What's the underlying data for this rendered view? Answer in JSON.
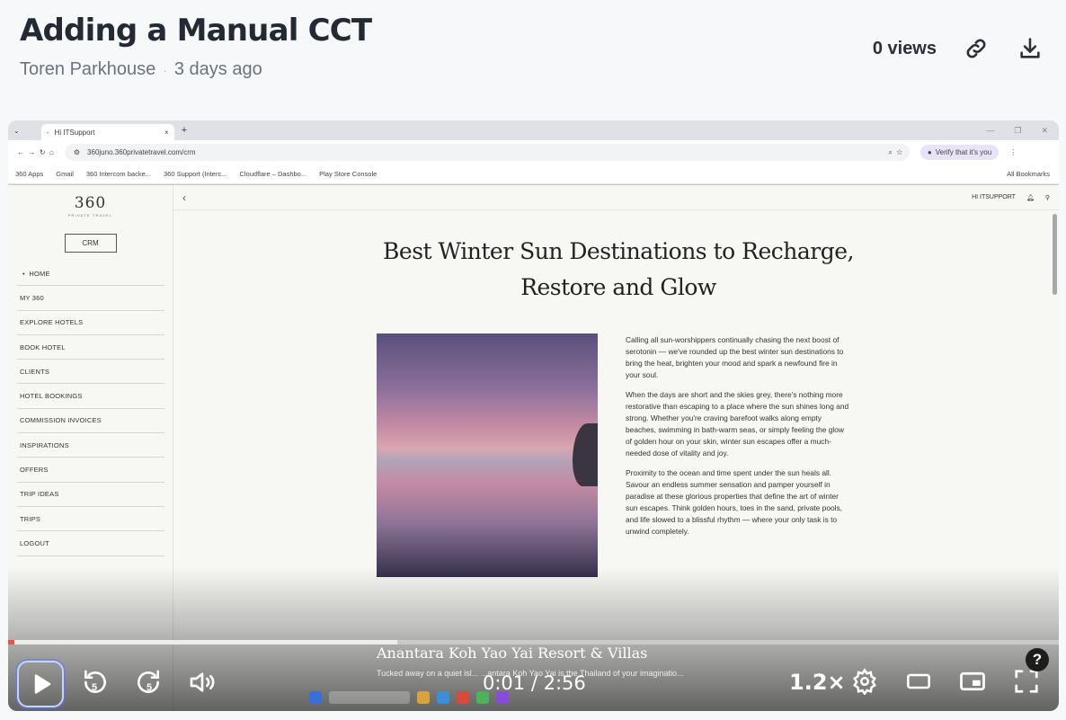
{
  "video": {
    "title": "Adding a Manual CCT",
    "author": "Toren Parkhouse",
    "separator": "·",
    "posted": "3 days ago",
    "views": "0 views"
  },
  "browser": {
    "tab_title": "Hi ITSupport",
    "url": "360juno.360privatetravel.com/crm",
    "verify_label": "Verify that it's you",
    "bookmarks": [
      "360 Apps",
      "Gmail",
      "360 Intercom backe...",
      "360 Support (Interc...",
      "Cloudflare – Dashbo...",
      "Play Store Console"
    ],
    "all_bookmarks": "All Bookmarks"
  },
  "site": {
    "logo": "360",
    "logo_sub": "PRIVATE TRAVEL",
    "crm_button": "CRM",
    "greeting": "HI ITSUPPORT",
    "nav": [
      "HOME",
      "MY 360",
      "EXPLORE HOTELS",
      "BOOK HOTEL",
      "CLIENTS",
      "HOTEL BOOKINGS",
      "COMMISSION INVOICES",
      "INSPIRATIONS",
      "OFFERS",
      "TRIP IDEAS",
      "TRIPS",
      "LOGOUT"
    ]
  },
  "article": {
    "title_line1": "Best Winter Sun Destinations to Recharge,",
    "title_line2": "Restore and Glow",
    "paragraphs": [
      "Calling all sun-worshippers continually chasing the next boost of serotonin — we've rounded up the best winter sun destinations to bring the heat, brighten your mood and spark a newfound fire in your soul.",
      "When the days are short and the skies grey, there's nothing more restorative than escaping to a place where the sun shines long and strong. Whether you're craving barefoot walks along empty beaches, swimming in bath-warm seas, or simply feeling the glow of golden hour on your skin, winter sun escapes offer a much-needed dose of vitality and joy.",
      "Proximity to the ocean and time spent under the sun heals all. Savour an endless summer sensation and pamper yourself in paradise at these glorious properties that define the art of winter sun escapes. Think golden hours, toes in the sand, private pools, and life slowed to a blissful rhythm — where your only task is to unwind completely."
    ],
    "subheading": "Anantara Koh Yao Yai Resort & Villas",
    "subtext": "Tucked away on a quiet isl... ...antara Koh Yao Yai is the Thailand of your imaginatio..."
  },
  "player": {
    "current_time": "0:01",
    "duration": "2:56",
    "time_separator": " / ",
    "speed": "1.2×",
    "played_fraction": 0.006,
    "buffered_fraction": 0.37,
    "skip_back": "5",
    "skip_forward": "5",
    "help": "?"
  },
  "colors": {
    "progress": "#e5573f",
    "accent_focus": "#c7d3ff"
  }
}
